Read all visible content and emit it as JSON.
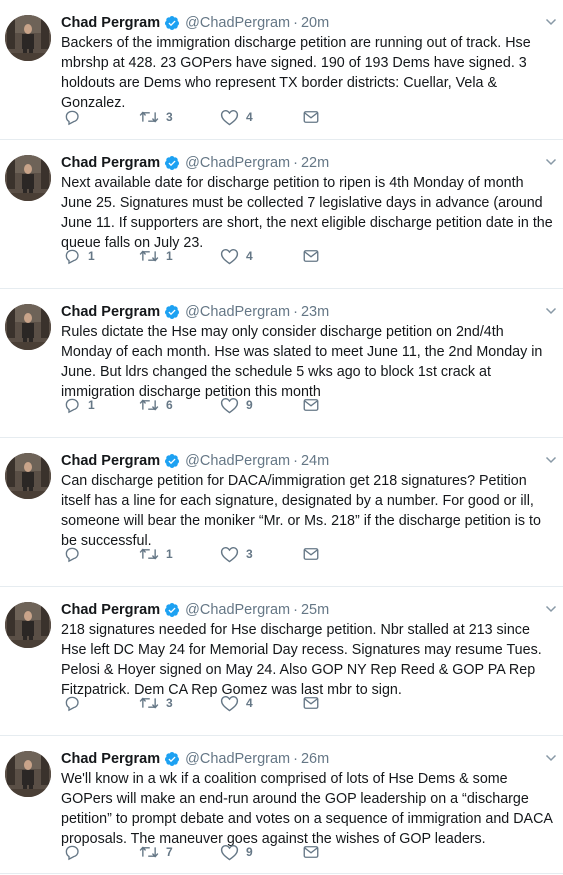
{
  "tweets": [
    {
      "name": "Chad Pergram",
      "handle": "@ChadPergram",
      "dot": "·",
      "time": "20m",
      "text": "Backers of the immigration discharge petition are running out of track. Hse mbrshp at 428. 23 GOPers have signed. 190 of 193 Dems have signed. 3 holdouts are Dems who represent TX border districts: Cuellar, Vela & Gonzalez.",
      "replies": "",
      "retweets": "3",
      "likes": "4"
    },
    {
      "name": "Chad Pergram",
      "handle": "@ChadPergram",
      "dot": "·",
      "time": "22m",
      "text": "Next available date for discharge petition to ripen is 4th Monday of month June 25. Signatures must be collected 7 legislative days in advance (around June 11. If supporters are short, the next eligible discharge petition date in the queue falls on July 23.",
      "replies": "1",
      "retweets": "1",
      "likes": "4"
    },
    {
      "name": "Chad Pergram",
      "handle": "@ChadPergram",
      "dot": "·",
      "time": "23m",
      "text": "Rules dictate the Hse may only consider discharge petition on 2nd/4th Monday of each month. Hse was slated to meet June 11, the 2nd Monday in June. But ldrs changed the schedule 5 wks ago to block 1st crack at immigration discharge petition this month",
      "replies": "1",
      "retweets": "6",
      "likes": "9"
    },
    {
      "name": "Chad Pergram",
      "handle": "@ChadPergram",
      "dot": "·",
      "time": "24m",
      "text": "Can discharge petition for DACA/immigration get 218 signatures? Petition itself has a line for each signature, designated by a number. For good or ill, someone will bear the moniker “Mr. or Ms. 218” if the discharge petition is to be successful.",
      "replies": "",
      "retweets": "1",
      "likes": "3"
    },
    {
      "name": "Chad Pergram",
      "handle": "@ChadPergram",
      "dot": "·",
      "time": "25m",
      "text": "218 signatures needed for Hse discharge petition. Nbr stalled at 213 since Hse left DC May 24 for Memorial Day recess. Signatures may resume Tues. Pelosi & Hoyer signed on May 24. Also GOP NY Rep Reed & GOP PA Rep Fitzpatrick. Dem CA Rep Gomez was last mbr to sign.",
      "replies": "",
      "retweets": "3",
      "likes": "4"
    },
    {
      "name": "Chad Pergram",
      "handle": "@ChadPergram",
      "dot": "·",
      "time": "26m",
      "text": "We'll know in a wk if a coalition comprised of lots of Hse Dems & some GOPers will make an end-run around the GOP leadership on a “discharge petition” to prompt debate and votes on a sequence of immigration and DACA proposals. The maneuver goes against the wishes of GOP leaders.",
      "replies": "",
      "retweets": "7",
      "likes": "9"
    }
  ],
  "icons": {
    "reply": "reply-icon",
    "retweet": "retweet-icon",
    "like": "heart-icon",
    "dm": "envelope-icon",
    "verified": "verified-badge-icon",
    "more": "chevron-down-icon"
  },
  "colors": {
    "verified": "#1da1f2",
    "muted": "#657786",
    "text": "#14171a",
    "divider": "#e6ecf0"
  }
}
